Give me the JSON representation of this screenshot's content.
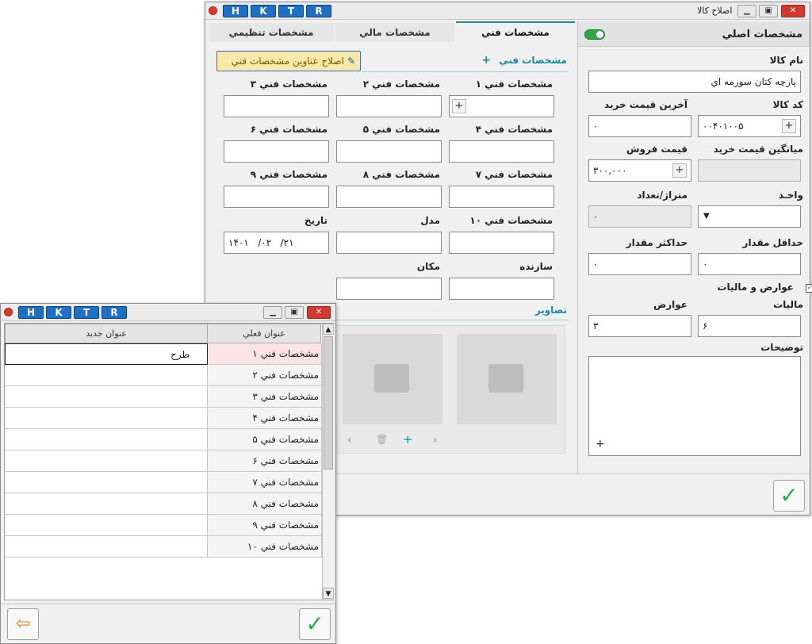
{
  "main_window": {
    "title": "اصلاح كالا",
    "hk_buttons": [
      "H",
      "K",
      "T",
      "R"
    ],
    "tabs": [
      "مشخصات فني",
      "مشخصات مالي",
      "مشخصات تنظيمي"
    ],
    "main_section": "مشخصات اصلي",
    "fields": {
      "name_label": "نام كالا",
      "name_value": "پارچه كتان سورمه اي",
      "code_label": "كد كالا",
      "code_value": "۰۰۴۰۱۰۰۵",
      "last_price_label": "آخرين قيمت خريد",
      "last_price_value": "۰",
      "avg_price_label": "ميانگين قيمت خريد",
      "avg_price_value": "",
      "sale_price_label": "قيمت فروش",
      "sale_price_value": "۳۰۰,۰۰۰",
      "unit_label": "واحـد",
      "unit_value": "",
      "meter_label": "متراژ/تعداد",
      "meter_value": "۰",
      "min_label": "حداقل مقدار",
      "min_value": "۰",
      "max_label": "حداكثر مقدار",
      "max_value": "۰",
      "tax_check_label": "عوارض و ماليات",
      "tax_label": "ماليات",
      "tax_value": "۶",
      "duty_label": "عوارض",
      "duty_value": "۳",
      "desc_label": "توضيحات"
    },
    "tech": {
      "section_title": "مشخصات فني",
      "edit_button": "اصلاح عناوين مشخصات فني",
      "labels": [
        "مشخصات فني ۱",
        "مشخصات فني ۲",
        "مشخصات فني ۳",
        "مشخصات فني ۴",
        "مشخصات فني ۵",
        "مشخصات فني ۶",
        "مشخصات فني ۷",
        "مشخصات فني ۸",
        "مشخصات فني ۹",
        "مشخصات فني ۱۰"
      ],
      "model_label": "مدل",
      "date_label": "تاريخ",
      "date_value": "۱۴۰۱   /۰۲   /۲۱",
      "maker_label": "سازنده",
      "place_label": "مكان",
      "images_title": "تصاوير"
    }
  },
  "titles_window": {
    "hk_buttons": [
      "H",
      "K",
      "T",
      "R"
    ],
    "col_current": "عنوان فعلي",
    "col_new": "عنوان جديد",
    "rows": [
      {
        "current": "مشخصات فني ۱",
        "new": "طرح"
      },
      {
        "current": "مشخصات فني ۲",
        "new": ""
      },
      {
        "current": "مشخصات فني ۳",
        "new": ""
      },
      {
        "current": "مشخصات فني ۴",
        "new": ""
      },
      {
        "current": "مشخصات فني ۵",
        "new": ""
      },
      {
        "current": "مشخصات فني ۶",
        "new": ""
      },
      {
        "current": "مشخصات فني ۷",
        "new": ""
      },
      {
        "current": "مشخصات فني ۸",
        "new": ""
      },
      {
        "current": "مشخصات فني ۹",
        "new": ""
      },
      {
        "current": "مشخصات فني ۱۰",
        "new": ""
      }
    ]
  },
  "colors": {
    "accent": "#1a8a9a",
    "hk_blue": "#1f6fc4",
    "ok_green": "#2ea84a",
    "highlight_row": "#fbe3e6",
    "edit_button_bg": "#f7e7a8"
  }
}
